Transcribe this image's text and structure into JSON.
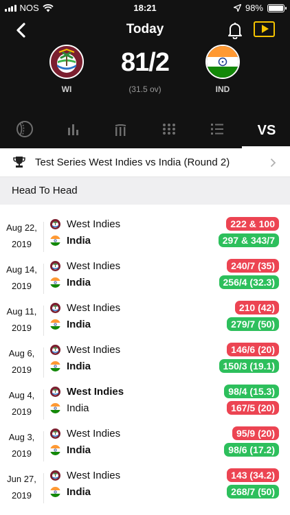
{
  "status_bar": {
    "carrier": "NOS",
    "time": "18:21",
    "battery": "98%",
    "battery_level": 0.98
  },
  "header": {
    "title": "Today"
  },
  "scoreboard": {
    "team1_code": "WI",
    "team2_code": "IND",
    "score": "81/2",
    "overs": "(31.5 ov)"
  },
  "tabs": [
    {
      "icon": "cricket-ball-icon"
    },
    {
      "icon": "bar-chart-icon"
    },
    {
      "icon": "wickets-icon"
    },
    {
      "icon": "dots-grid-icon"
    },
    {
      "icon": "numbered-list-icon"
    },
    {
      "label": "VS",
      "active": true
    }
  ],
  "series": {
    "title": "Test Series West Indies vs India (Round 2)"
  },
  "section": {
    "title": "Head To Head"
  },
  "colors": {
    "loss": "#ec4452",
    "win": "#2dbf5c",
    "accent": "#f5c400"
  },
  "matches": [
    {
      "date1": "Aug 22,",
      "date2": "2019",
      "team1": "West Indies",
      "team2": "India",
      "score1": "222 & 100",
      "score2": "297 & 343/7",
      "winner": 2
    },
    {
      "date1": "Aug 14,",
      "date2": "2019",
      "team1": "West Indies",
      "team2": "India",
      "score1": "240/7 (35)",
      "score2": "256/4 (32.3)",
      "winner": 2
    },
    {
      "date1": "Aug 11,",
      "date2": "2019",
      "team1": "West Indies",
      "team2": "India",
      "score1": "210 (42)",
      "score2": "279/7 (50)",
      "winner": 2
    },
    {
      "date1": "Aug 6,",
      "date2": "2019",
      "team1": "West Indies",
      "team2": "India",
      "score1": "146/6 (20)",
      "score2": "150/3 (19.1)",
      "winner": 2
    },
    {
      "date1": "Aug 4,",
      "date2": "2019",
      "team1": "West Indies",
      "team2": "India",
      "score1": "98/4 (15.3)",
      "score2": "167/5 (20)",
      "winner": 1
    },
    {
      "date1": "Aug 3,",
      "date2": "2019",
      "team1": "West Indies",
      "team2": "India",
      "score1": "95/9 (20)",
      "score2": "98/6 (17.2)",
      "winner": 2
    },
    {
      "date1": "Jun 27,",
      "date2": "2019",
      "team1": "West Indies",
      "team2": "India",
      "score1": "143 (34.2)",
      "score2": "268/7 (50)",
      "winner": 2
    }
  ]
}
